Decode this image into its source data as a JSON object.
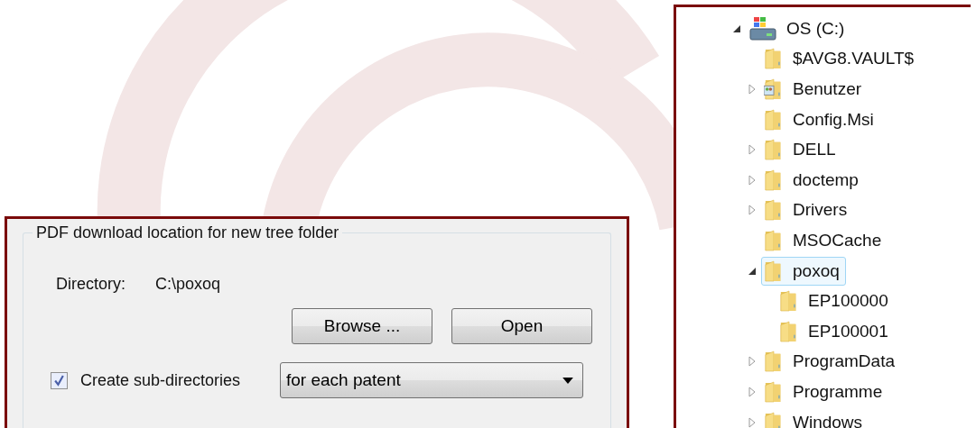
{
  "settings_panel": {
    "group_title": "PDF download location for new tree folder",
    "directory_label": "Directory:",
    "directory_value": "C:\\poxoq",
    "buttons": [
      "Browse ...",
      "Open"
    ],
    "subdirectories": {
      "label": "Create sub-directories",
      "checked": true
    },
    "dropdown": {
      "value": "for each patent"
    }
  },
  "folder_tree": [
    {
      "label": "OS (C:)",
      "kind": "drive",
      "expanded": true,
      "selected": false,
      "children": [
        {
          "label": "$AVG8.VAULT$",
          "kind": "folder",
          "selected": false
        },
        {
          "label": "Benutzer",
          "kind": "user-folder",
          "expanded": false,
          "selected": false
        },
        {
          "label": "Config.Msi",
          "kind": "folder",
          "selected": false
        },
        {
          "label": "DELL",
          "kind": "folder",
          "expanded": false,
          "selected": false
        },
        {
          "label": "doctemp",
          "kind": "folder",
          "expanded": false,
          "selected": false
        },
        {
          "label": "Drivers",
          "kind": "folder",
          "expanded": false,
          "selected": false
        },
        {
          "label": "MSOCache",
          "kind": "folder",
          "selected": false
        },
        {
          "label": "poxoq",
          "kind": "folder",
          "expanded": true,
          "selected": true,
          "children": [
            {
              "label": "EP100000",
              "kind": "folder",
              "selected": false
            },
            {
              "label": "EP100001",
              "kind": "folder",
              "selected": false
            }
          ]
        },
        {
          "label": "ProgramData",
          "kind": "folder",
          "expanded": false,
          "selected": false
        },
        {
          "label": "Programme",
          "kind": "folder",
          "expanded": false,
          "selected": false
        },
        {
          "label": "Windows",
          "kind": "folder",
          "expanded": false,
          "selected": false
        }
      ]
    }
  ]
}
